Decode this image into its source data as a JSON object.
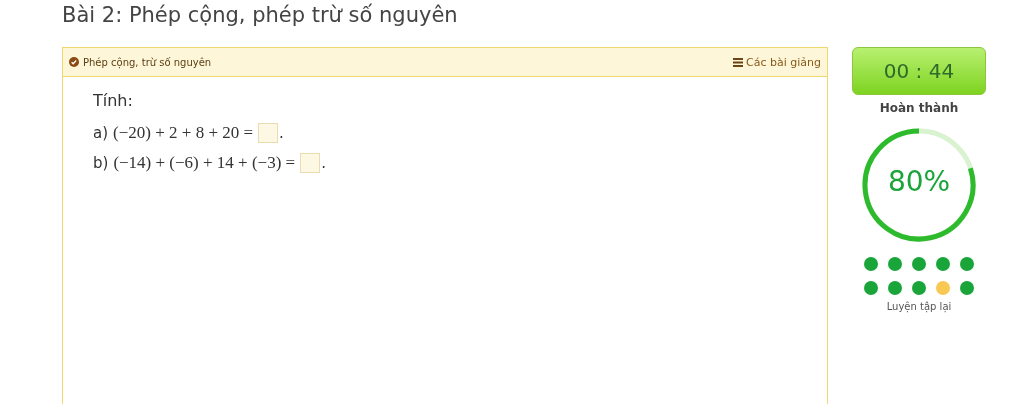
{
  "page_title": "Bài 2: Phép cộng, phép trừ số nguyên",
  "card": {
    "topic": "Phép cộng, trừ số nguyên",
    "lectures_link": "Các bài giảng",
    "instruction": "Tính:",
    "questions": [
      {
        "label": "a)",
        "expression": "(−20) + 2 + 8 + 20 =",
        "suffix": "."
      },
      {
        "label": "b)",
        "expression": "(−14) + (−6) + 14 + (−3) =",
        "suffix": "."
      }
    ]
  },
  "sidebar": {
    "timer": "00 : 44",
    "finish_label": "Hoàn thành",
    "progress": {
      "reading": "80%"
    },
    "answers": [
      {
        "color": "#1aa53a"
      },
      {
        "color": "#1aa53a"
      },
      {
        "color": "#1aa53a"
      },
      {
        "color": "#1aa53a"
      },
      {
        "color": "#1aa53a"
      },
      {
        "color": "#1aa53a"
      },
      {
        "color": "#1aa53a"
      },
      {
        "color": "#1aa53a"
      },
      {
        "color": "#f8c852"
      },
      {
        "color": "#1aa53a"
      }
    ],
    "retry_link": "Luyện tập lại"
  }
}
